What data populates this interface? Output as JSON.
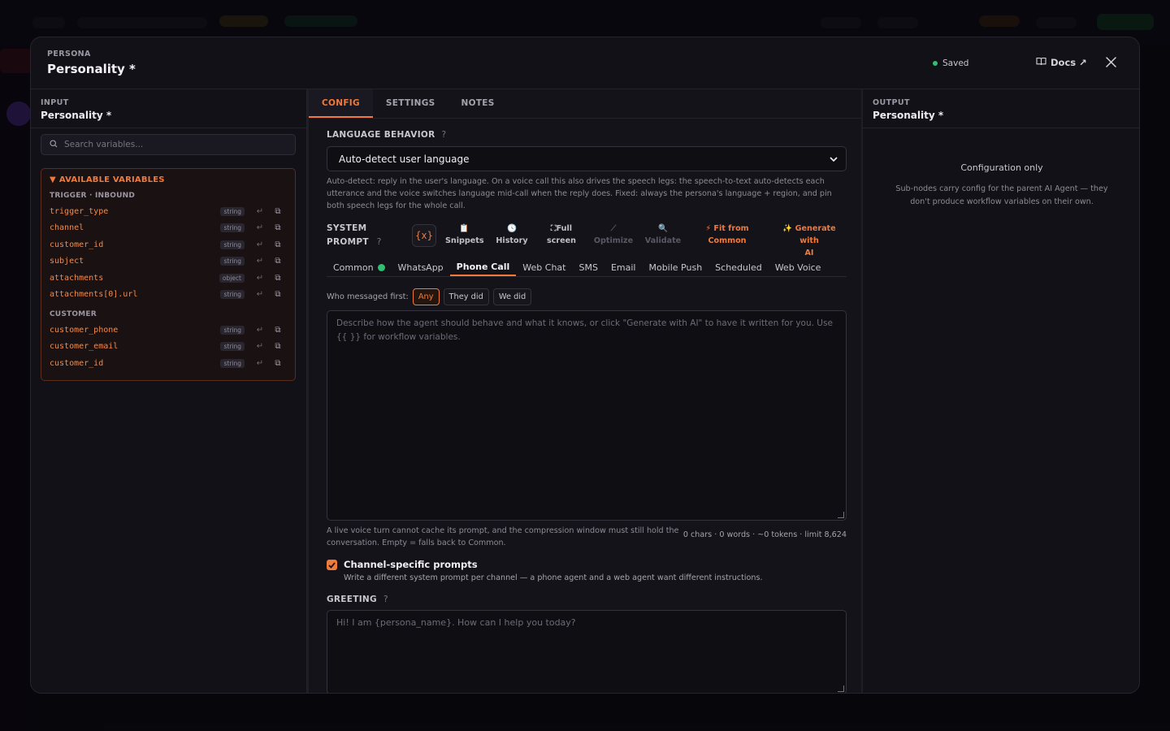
{
  "header": {
    "eyebrow": "PERSONA",
    "title": "Personality *",
    "saved_label": "Saved",
    "docs_label": "Docs ↗"
  },
  "input_pane": {
    "eyebrow": "INPUT",
    "title": "Personality *",
    "search_placeholder": "Search variables...",
    "vars_title": "AVAILABLE VARIABLES",
    "groups": [
      {
        "label": "TRIGGER · INBOUND",
        "vars": [
          {
            "name": "trigger_type",
            "type": "string"
          },
          {
            "name": "channel",
            "type": "string"
          },
          {
            "name": "customer_id",
            "type": "string"
          },
          {
            "name": "subject",
            "type": "string"
          },
          {
            "name": "attachments",
            "type": "object"
          },
          {
            "name": "attachments[0].url",
            "type": "string"
          }
        ]
      },
      {
        "label": "CUSTOMER",
        "vars": [
          {
            "name": "customer_phone",
            "type": "string"
          },
          {
            "name": "customer_email",
            "type": "string"
          },
          {
            "name": "customer_id",
            "type": "string"
          }
        ]
      }
    ]
  },
  "tabs": [
    {
      "label": "CONFIG",
      "active": true
    },
    {
      "label": "SETTINGS",
      "active": false
    },
    {
      "label": "NOTES",
      "active": false
    }
  ],
  "config": {
    "language_label": "LANGUAGE BEHAVIOR",
    "language_value": "Auto-detect user language",
    "language_help": "Auto-detect: reply in the user's language. On a voice call this also drives the speech legs: the speech-to-text auto-detects each utterance and the voice switches language mid-call when the reply does. Fixed: always the persona's language + region, and pin both speech legs for the whole call.",
    "system_prompt_label_1": "SYSTEM",
    "system_prompt_label_2": "PROMPT",
    "variable_button": "{x}",
    "tools": {
      "snippets": "Snippets",
      "history": "History",
      "fullscreen_1": "Full",
      "fullscreen_2": "screen",
      "optimize": "Optimize",
      "validate": "Validate",
      "fit_1": "Fit from",
      "fit_2": "Common",
      "generate_1": "Generate with",
      "generate_2": "AI"
    },
    "channel_tabs": [
      {
        "label": "Common",
        "active": false,
        "dot": true
      },
      {
        "label": "WhatsApp",
        "active": false
      },
      {
        "label": "Phone Call",
        "active": true
      },
      {
        "label": "Web Chat",
        "active": false
      },
      {
        "label": "SMS",
        "active": false
      },
      {
        "label": "Email",
        "active": false
      },
      {
        "label": "Mobile Push",
        "active": false
      },
      {
        "label": "Scheduled",
        "active": false
      },
      {
        "label": "Web Voice",
        "active": false
      }
    ],
    "who_label": "Who messaged first:",
    "who_options": [
      {
        "label": "Any",
        "active": true
      },
      {
        "label": "They did",
        "active": false
      },
      {
        "label": "We did",
        "active": false
      }
    ],
    "prompt_placeholder": "Describe how the agent should behave and what it knows, or click \"Generate with AI\" to have it written for you. Use {{ }} for workflow variables.",
    "prompt_note": "A live voice turn cannot cache its prompt, and the compression window must still hold the conversation. Empty = falls back to Common.",
    "counter": "0 chars · 0 words · ~0 tokens · limit 8,624",
    "channel_specific_title": "Channel-specific prompts",
    "channel_specific_sub": "Write a different system prompt per channel — a phone agent and a web agent want different instructions.",
    "channel_specific_checked": true,
    "greeting_label": "GREETING",
    "greeting_placeholder": "Hi! I am {persona_name}. How can I help you today?"
  },
  "output_pane": {
    "eyebrow": "OUTPUT",
    "title": "Personality *",
    "empty_title": "Configuration only",
    "empty_sub": "Sub-nodes carry config for the parent AI Agent — they don't produce workflow variables on their own."
  },
  "colors": {
    "accent": "#f07a3c",
    "success": "#2fbf71"
  }
}
